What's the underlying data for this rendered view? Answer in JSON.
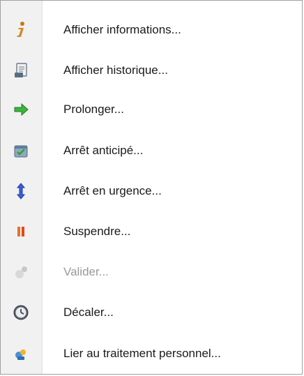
{
  "menu": {
    "items": [
      {
        "label": "Afficher informations...",
        "icon": "info-icon",
        "enabled": true
      },
      {
        "label": "Afficher historique...",
        "icon": "history-document-icon",
        "enabled": true
      },
      {
        "label": "Prolonger...",
        "icon": "green-arrow-right-icon",
        "enabled": true
      },
      {
        "label": "Arrêt anticipé...",
        "icon": "calendar-check-icon",
        "enabled": true
      },
      {
        "label": "Arrêt en urgence...",
        "icon": "double-arrow-vertical-icon",
        "enabled": true
      },
      {
        "label": "Suspendre...",
        "icon": "pause-icon",
        "enabled": true
      },
      {
        "label": "Valider...",
        "icon": "validate-icon",
        "enabled": false
      },
      {
        "label": "Décaler...",
        "icon": "clock-icon",
        "enabled": true
      },
      {
        "label": "Lier au traitement personnel...",
        "icon": "link-personal-icon",
        "enabled": true
      }
    ]
  }
}
